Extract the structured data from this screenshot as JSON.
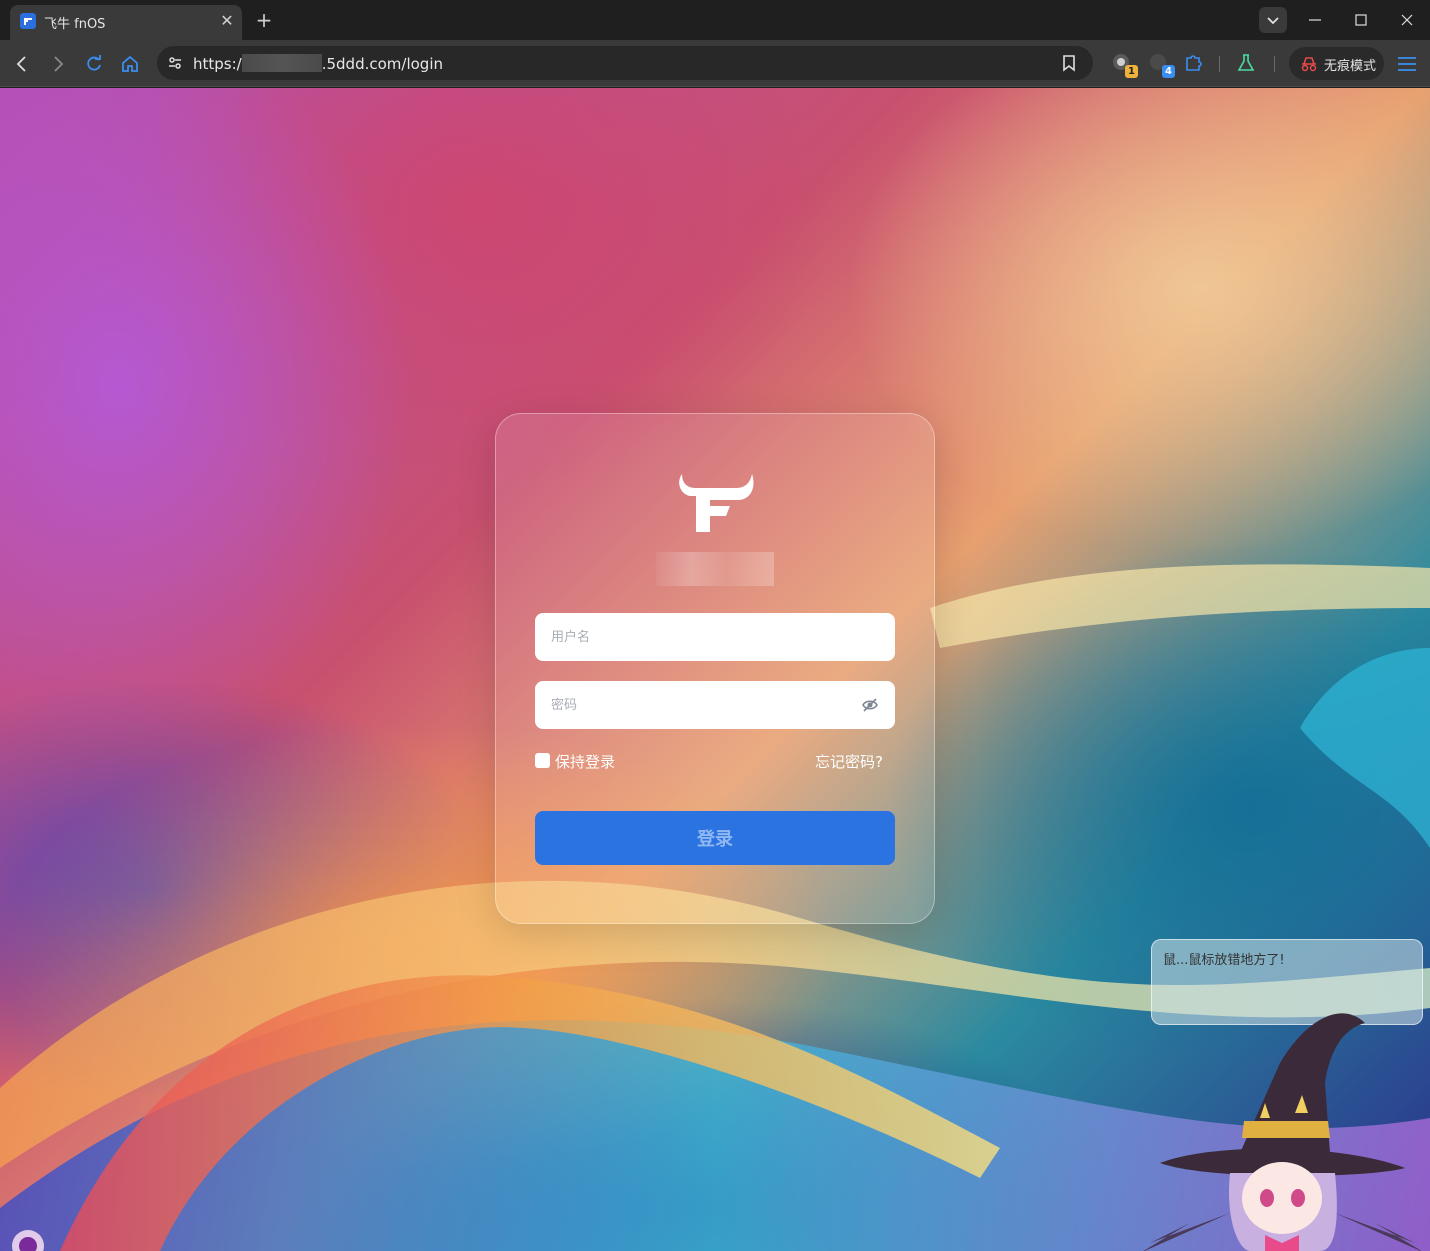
{
  "browser": {
    "tab": {
      "title": "飞牛 fnOS",
      "close": "✕"
    },
    "new_tab": "+",
    "url": {
      "prefix": "https:/",
      "suffix": ".5ddd.com/login"
    },
    "extensions": [
      {
        "name": "extension-1",
        "badge": "1",
        "badge_color": "#f0b23a"
      },
      {
        "name": "extension-2",
        "badge": "4",
        "badge_color": "#3a8ef0"
      }
    ],
    "incognito_label": "无痕模式"
  },
  "login": {
    "username_placeholder": "用户名",
    "password_placeholder": "密码",
    "remember_label": "保持登录",
    "forgot_label": "忘记密码?",
    "submit_label": "登录"
  },
  "mascot": {
    "speech": "鼠...鼠标放错地方了!"
  },
  "colors": {
    "accent": "#2a73e0",
    "chrome_bg": "#1f1f1f",
    "toolbar_bg": "#3a3a3a"
  }
}
